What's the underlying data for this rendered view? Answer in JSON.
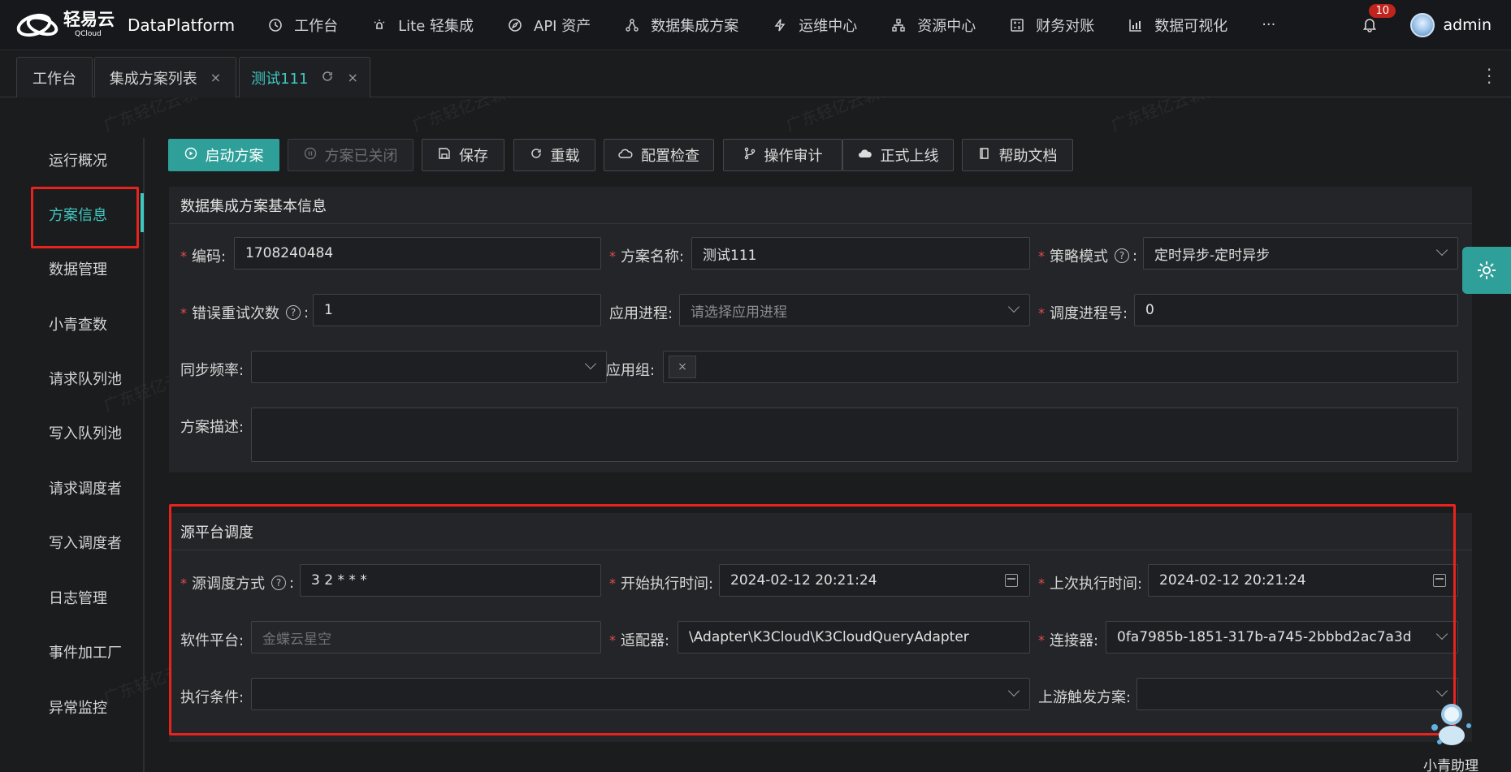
{
  "topbar": {
    "app_name": "DataPlatform",
    "logo_cn": "轻易云",
    "logo_en": "QCloud",
    "nav": [
      {
        "label": "工作台",
        "icon": "clock-icon"
      },
      {
        "label": "Lite 轻集成",
        "icon": "bulb-icon"
      },
      {
        "label": "API 资产",
        "icon": "compass-icon"
      },
      {
        "label": "数据集成方案",
        "icon": "network-icon"
      },
      {
        "label": "运维中心",
        "icon": "lightning-icon"
      },
      {
        "label": "资源中心",
        "icon": "sitemap-icon"
      },
      {
        "label": "财务对账",
        "icon": "calculator-icon"
      },
      {
        "label": "数据可视化",
        "icon": "chart-icon"
      }
    ],
    "more": "···",
    "notification_count": "10",
    "username": "admin"
  },
  "tabs": [
    {
      "label": "工作台"
    },
    {
      "label": "集成方案列表",
      "close": "×"
    },
    {
      "label": "测试111",
      "close": "×"
    }
  ],
  "sidemenu": [
    "运行概况",
    "方案信息",
    "数据管理",
    "小青查数",
    "请求队列池",
    "写入队列池",
    "请求调度者",
    "写入调度者",
    "日志管理",
    "事件加工厂",
    "异常监控"
  ],
  "toolbar": {
    "start": "启动方案",
    "closed": "方案已关闭",
    "save": "保存",
    "reload": "重载",
    "check": "配置检查",
    "audit": "操作审计",
    "publish": "正式上线",
    "help": "帮助文档"
  },
  "basic": {
    "title": "数据集成方案基本信息",
    "code_label": "编码:",
    "code_value": "1708240484",
    "name_label": "方案名称:",
    "name_value": "测试111",
    "strategy_label": "策略模式",
    "strategy_value": "定时异步-定时异步",
    "retry_label": "错误重试次数",
    "retry_value": "1",
    "process_label": "应用进程:",
    "process_placeholder": "请选择应用进程",
    "sched_proc_label": "调度进程号:",
    "sched_proc_value": "0",
    "sync_label": "同步频率:",
    "group_label": "应用组:",
    "group_tag": "×",
    "desc_label": "方案描述:"
  },
  "source": {
    "title": "源平台调度",
    "mode_label": "源调度方式",
    "mode_value": "3 2 * * *",
    "start_label": "开始执行时间:",
    "start_value": "2024-02-12 20:21:24",
    "last_label": "上次执行时间:",
    "last_value": "2024-02-12 20:21:24",
    "platform_label": "软件平台:",
    "platform_value": "金蝶云星空",
    "adapter_label": "适配器:",
    "adapter_value": "\\Adapter\\K3Cloud\\K3CloudQueryAdapter",
    "connector_label": "连接器:",
    "connector_value": "0fa7985b-1851-317b-a745-2bbbd2ac7a3d",
    "cond_label": "执行条件:",
    "upstream_label": "上游触发方案:"
  },
  "assistant_label": "小青助理",
  "watermark": "广东轻亿云软件科技有限公司",
  "colors": {
    "accent": "#3fc8c0",
    "primary_btn": "#2f9f99",
    "highlight": "#e8231d"
  }
}
